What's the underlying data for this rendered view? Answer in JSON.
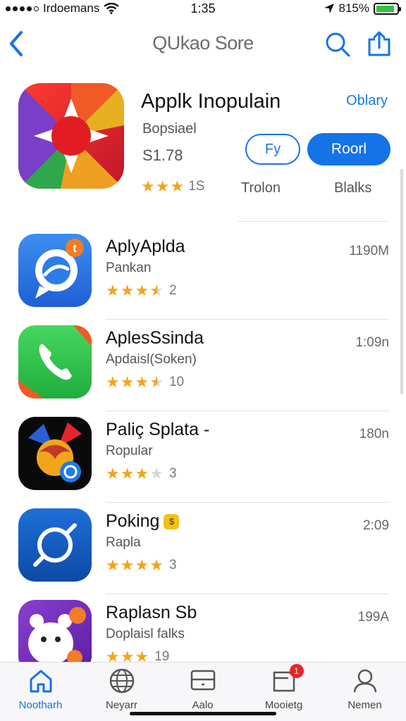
{
  "status_bar": {
    "carrier": "Irdoemans",
    "time": "1:35",
    "battery": "815%",
    "battery_level": 0.9
  },
  "nav": {
    "title": "QUkao Sore",
    "back_icon": "chevron-left-icon",
    "search_icon": "search-icon",
    "share_icon": "share-icon"
  },
  "featured": {
    "title": "Applk Inopulain",
    "link": "Oblary",
    "subtitle": "Bopsiael",
    "price": "S1.78",
    "outline_button": "Fy",
    "solid_button": "Roorl",
    "rating": 3,
    "rating_count": "1S",
    "meta_1": "Trolon",
    "meta_2": "Blalks"
  },
  "apps": [
    {
      "title": "AplyAplda",
      "subtitle": "Pankan",
      "rating": 3.5,
      "rating_count": "2",
      "right": "1190M",
      "badge": ""
    },
    {
      "title": "AplesSsinda",
      "subtitle": "Apdaisl(Soken)",
      "rating": 3.5,
      "rating_count": "10",
      "right": "1:09n",
      "badge": ""
    },
    {
      "title": "Paliç Splata -",
      "subtitle": "Ropular",
      "rating": 3,
      "rating_count": "3",
      "right": "180n",
      "badge": ""
    },
    {
      "title": "Poking",
      "subtitle": "Rapla",
      "rating": 4,
      "rating_count": "3",
      "right": "2:09",
      "badge": "$"
    },
    {
      "title": "Raplasn Sb",
      "subtitle": "Doplaisl falks",
      "rating": 3,
      "rating_count": "19",
      "right": "199A",
      "badge": ""
    }
  ],
  "tabs": [
    {
      "label": "Nootharh",
      "icon": "home-icon",
      "active": true,
      "badge": ""
    },
    {
      "label": "Neyarr",
      "icon": "globe-icon",
      "active": false,
      "badge": ""
    },
    {
      "label": "Aalo",
      "icon": "window-icon",
      "active": false,
      "badge": ""
    },
    {
      "label": "Mooietg",
      "icon": "inbox-icon",
      "active": false,
      "badge": "1"
    },
    {
      "label": "Nemen",
      "icon": "profile-icon",
      "active": false,
      "badge": ""
    }
  ],
  "colors": {
    "accent": "#1473e6",
    "star": "#f2a51a",
    "badge": "#e8242b"
  }
}
